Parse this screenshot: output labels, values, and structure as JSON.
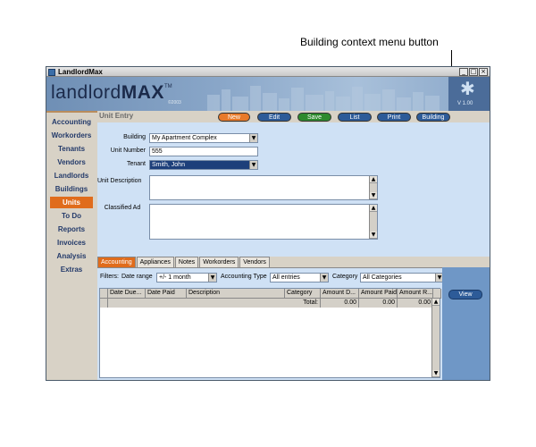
{
  "annotation": {
    "callout_text": "Building context menu button"
  },
  "window": {
    "title": "LandlordMax",
    "logo_main": "landlord",
    "logo_bold": "MAX",
    "logo_tm": "TM",
    "copyright": "©2003",
    "version": "V 1.00"
  },
  "sidebar": {
    "items": [
      {
        "label": "Accounting"
      },
      {
        "label": "Workorders"
      },
      {
        "label": "Tenants"
      },
      {
        "label": "Vendors"
      },
      {
        "label": "Landlords"
      },
      {
        "label": "Buildings"
      },
      {
        "label": "Units"
      },
      {
        "label": "To Do"
      },
      {
        "label": "Reports"
      },
      {
        "label": "Invoices"
      },
      {
        "label": "Analysis"
      },
      {
        "label": "Extras"
      }
    ],
    "active": "Units"
  },
  "toolbar": {
    "section_title": "Unit Entry",
    "new_label": "New",
    "edit_label": "Edit",
    "save_label": "Save",
    "list_label": "List",
    "print_label": "Print",
    "building_label": "Building"
  },
  "form": {
    "building_label": "Building",
    "building_value": "My Apartment Complex",
    "unit_number_label": "Unit Number",
    "unit_number_value": "555",
    "tenant_label": "Tenant",
    "tenant_value": "Smith, John",
    "unit_description_label": "Unit Description",
    "classified_ad_label": "Classified Ad"
  },
  "tabs": [
    {
      "label": "Accounting"
    },
    {
      "label": "Appliances"
    },
    {
      "label": "Notes"
    },
    {
      "label": "Workorders"
    },
    {
      "label": "Vendors"
    }
  ],
  "filters": {
    "filters_label": "Filters:",
    "date_range_label": "Date range",
    "date_range_value": "+/- 1 month",
    "accounting_type_label": "Accounting Type",
    "accounting_type_value": "All entries",
    "category_label": "Category",
    "category_value": "All Categories"
  },
  "table": {
    "columns": [
      "Date Due...",
      "Date Paid",
      "Description",
      "Category",
      "Amount D...",
      "Amount Paid",
      "Amount R..."
    ],
    "total_label": "Total:",
    "totals": [
      "0.00",
      "0.00",
      "0.00"
    ]
  },
  "right_panel": {
    "view_label": "View"
  },
  "colors": {
    "accent_orange": "#e06c1c",
    "button_blue": "#2d5b98",
    "button_green": "#2e8a2e",
    "panel_light_blue": "#cfe1f5"
  }
}
